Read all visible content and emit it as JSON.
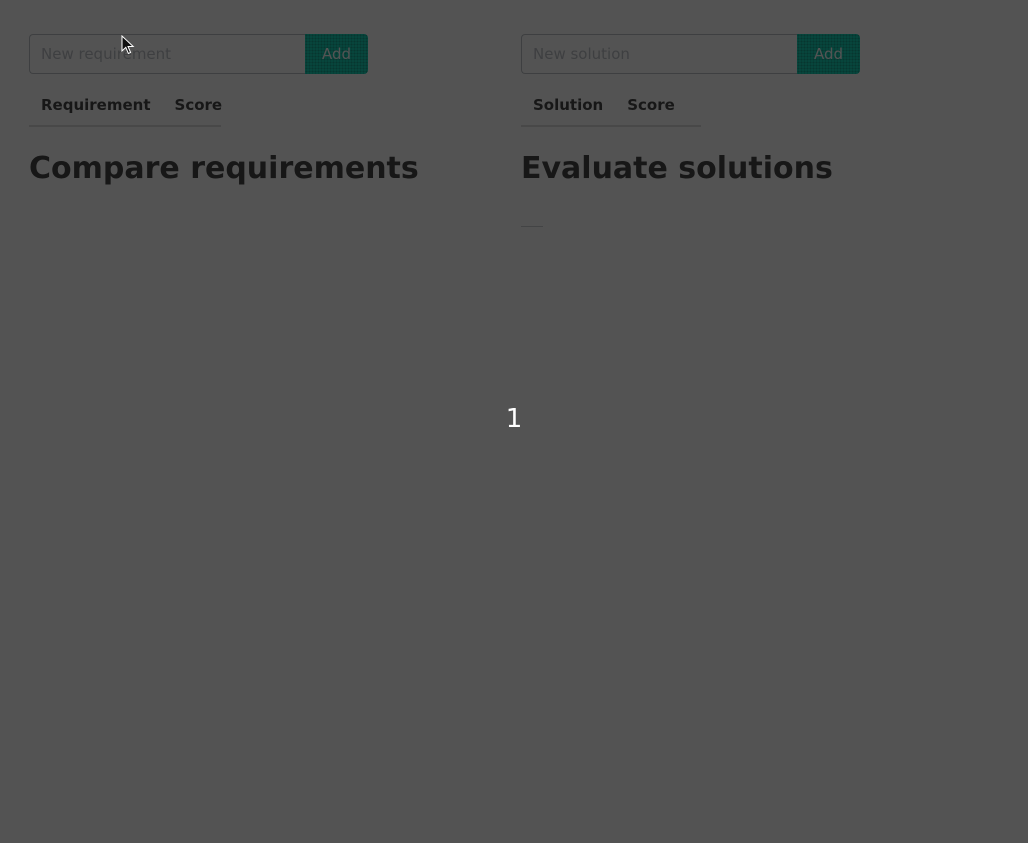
{
  "requirements": {
    "input_placeholder": "New requirement",
    "add_label": "Add",
    "columns": [
      "Requirement",
      "Score"
    ],
    "title": "Compare requirements"
  },
  "solutions": {
    "input_placeholder": "New solution",
    "add_label": "Add",
    "columns": [
      "Solution",
      "Score"
    ],
    "title": "Evaluate solutions"
  },
  "overlay": {
    "counter": "1"
  },
  "colors": {
    "accent": "#00d1b2",
    "text": "#363636",
    "overlay": "#52555e"
  },
  "icons": {
    "cursor": "mouse-pointer-icon"
  }
}
